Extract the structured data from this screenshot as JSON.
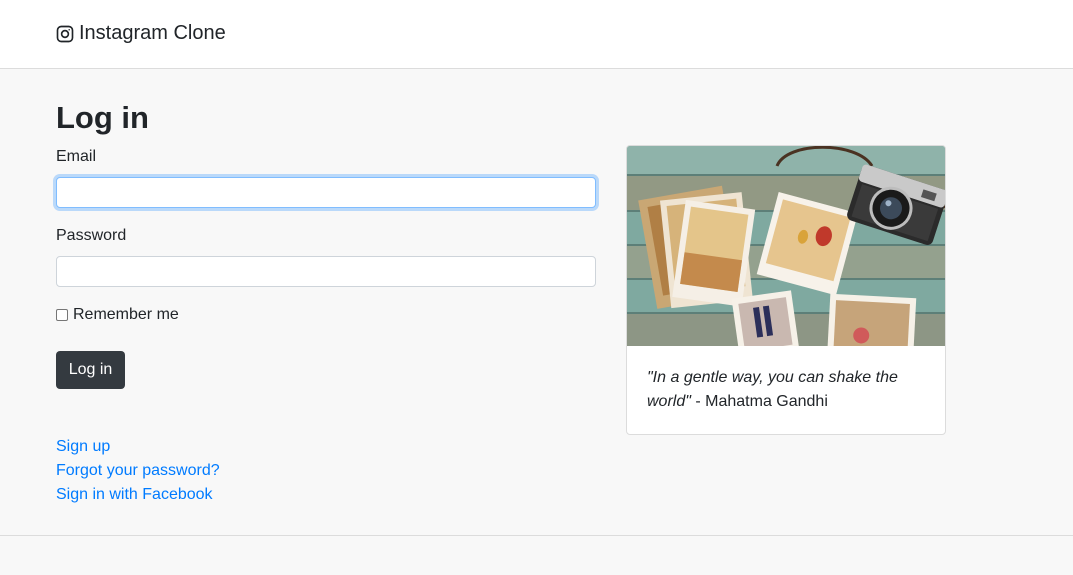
{
  "navbar": {
    "brand_icon": "instagram-icon",
    "brand_title": "Instagram Clone"
  },
  "login": {
    "heading": "Log in",
    "email_label": "Email",
    "email_value": "",
    "password_label": "Password",
    "password_value": "",
    "remember_label": "Remember me",
    "remember_checked": false,
    "submit_label": "Log in"
  },
  "links": {
    "sign_up": "Sign up",
    "forgot": "Forgot your password?",
    "facebook": "Sign in with Facebook"
  },
  "card": {
    "image_desc": "vintage-photos-camera-image",
    "quote_text": "\"In a gentle way, you can shake the world\"",
    "quote_author": " - Mahatma Gandhi"
  },
  "colors": {
    "link": "#007bff",
    "button": "#343a40",
    "focus": "#80bdff"
  }
}
